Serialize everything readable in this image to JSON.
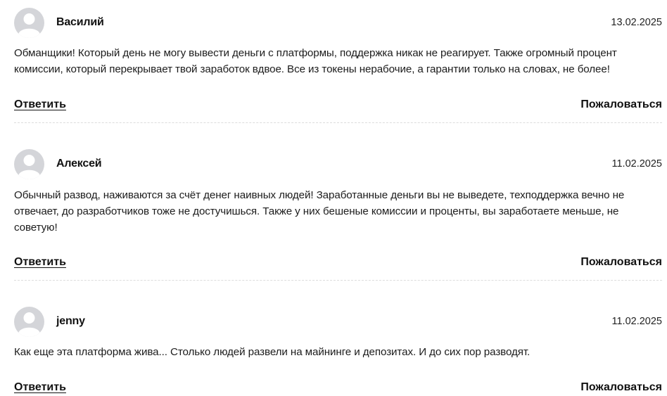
{
  "icons": {
    "avatar": "user-avatar-icon"
  },
  "colors": {
    "avatar_bg": "#d4d5d9",
    "avatar_fg": "#ffffff",
    "divider": "#dcdcdc",
    "text": "#1c1c1c"
  },
  "comments": [
    {
      "author": "Василий",
      "date": "13.02.2025",
      "text": "Обманщики! Который день не могу вывести деньги с платформы, поддержка никак не реагирует. Также огромный процент комиссии, который перекрывает твой заработок вдвое. Все из токены нерабочие, а гарантии только на словах, не более!",
      "reply_label": "Ответить",
      "report_label": "Пожаловаться"
    },
    {
      "author": "Алексей",
      "date": "11.02.2025",
      "text": "Обычный развод, наживаются за счёт денег наивных людей! Заработанные деньги вы не выведете, техподдержка вечно не отвечает, до разработчиков тоже не достучишься. Также у них бешеные комиссии и проценты, вы заработаете меньше, не советую!",
      "reply_label": "Ответить",
      "report_label": "Пожаловаться"
    },
    {
      "author": "jenny",
      "date": "11.02.2025",
      "text": "Как еще эта платформа жива... Столько людей развели на майнинге и депозитах. И до сих пор разводят.",
      "reply_label": "Ответить",
      "report_label": "Пожаловаться"
    }
  ]
}
